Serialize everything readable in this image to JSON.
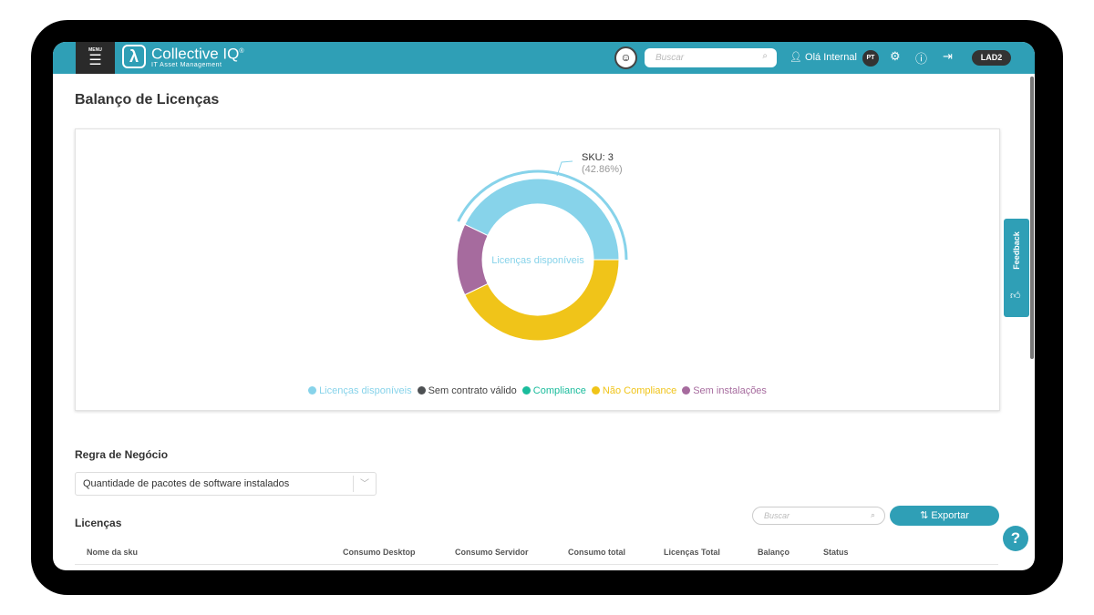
{
  "header": {
    "menu_label": "MENU",
    "logo_title": "Collective IQ",
    "logo_reg": "®",
    "logo_subtitle": "IT Asset Management",
    "search_placeholder": "Buscar",
    "greeting": "Olá Internal",
    "language": "PT",
    "tenant": "LAD2"
  },
  "page": {
    "title": "Balanço de Licenças"
  },
  "chart_data": {
    "type": "pie",
    "donut": true,
    "center_label": "Licenças disponíveis",
    "categories": [
      "Licenças disponíveis",
      "Sem contrato válido",
      "Compliance",
      "Não Compliance",
      "Sem instalações"
    ],
    "values": [
      3,
      0,
      0,
      3,
      1
    ],
    "colors": [
      "#87d3ea",
      "#4d5053",
      "#1abc9c",
      "#f0c419",
      "#a66b9e"
    ],
    "tooltip": {
      "label": "SKU: 3",
      "percent": "(42.86%)"
    },
    "legend_position": "bottom"
  },
  "business_rule": {
    "label": "Regra de Negócio",
    "selected": "Quantidade de pacotes de software instalados"
  },
  "licenses": {
    "label": "Licenças",
    "search_placeholder": "Buscar",
    "export_label": "Exportar",
    "columns": [
      "Nome da sku",
      "Consumo Desktop",
      "Consumo Servidor",
      "Consumo total",
      "Licenças Total",
      "Balanço",
      "Status"
    ]
  },
  "feedback": {
    "label": "Feedback"
  },
  "help": {
    "label": "?"
  }
}
